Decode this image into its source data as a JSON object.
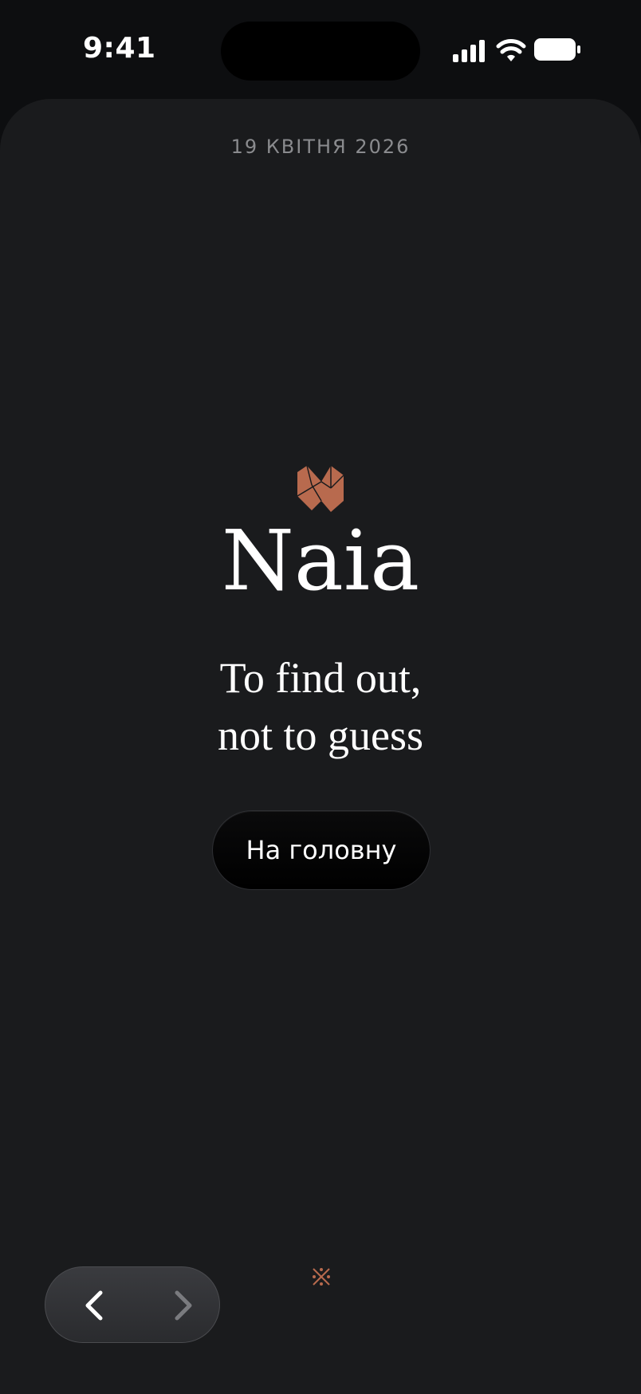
{
  "status_bar": {
    "time": "9:41",
    "icons": [
      "cellular-signal-icon",
      "wifi-icon",
      "battery-icon"
    ]
  },
  "page": {
    "date": "19 КВІТНЯ 2026",
    "brand": "Naia",
    "tagline": {
      "line1": "To find out,",
      "line2": "not to guess"
    },
    "home_button_label": "На головну"
  },
  "navigation": {
    "back_icon": "chevron-left-icon",
    "forward_icon": "chevron-right-icon",
    "decoration_icon": "asterism-icon"
  },
  "colors": {
    "background": "#1a1b1d",
    "accent": "#b86a4e",
    "text_primary": "#ffffff",
    "text_muted": "#8a8b8e"
  }
}
